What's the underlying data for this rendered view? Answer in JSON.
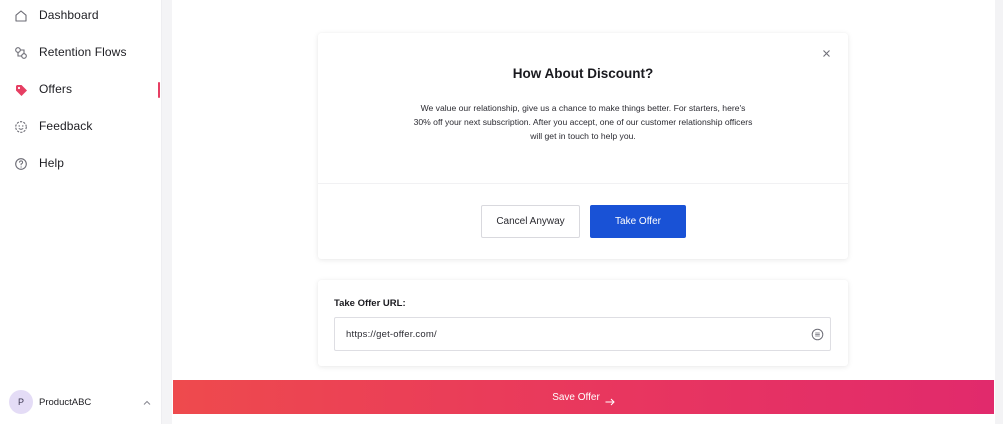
{
  "sidebar": {
    "items": [
      {
        "label": "Dashboard",
        "icon": "home-icon",
        "active": false
      },
      {
        "label": "Retention Flows",
        "icon": "flows-icon",
        "active": false
      },
      {
        "label": "Offers",
        "icon": "tag-icon",
        "active": true
      },
      {
        "label": "Feedback",
        "icon": "feedback-icon",
        "active": false
      },
      {
        "label": "Help",
        "icon": "help-icon",
        "active": false
      }
    ],
    "user": {
      "initial": "P",
      "name": "ProductABC",
      "chevron": "chevron-up-icon"
    }
  },
  "modal": {
    "title": "How About Discount?",
    "body": "We value our relationship, give us a chance to make things better. For starters, here's 30% off your next subscription. After you accept, one of our customer relationship officers will get in touch to help you.",
    "cancel_label": "Cancel Anyway",
    "take_label": "Take Offer"
  },
  "url_card": {
    "label": "Take Offer URL:",
    "value": "https://get-offer.com/"
  },
  "footer": {
    "save_label": "Save Offer"
  },
  "colors": {
    "accent": "#e63f63",
    "primary_button": "#1952d6",
    "save_gradient_start": "#ee4a4d",
    "save_gradient_end": "#e12a6c"
  }
}
